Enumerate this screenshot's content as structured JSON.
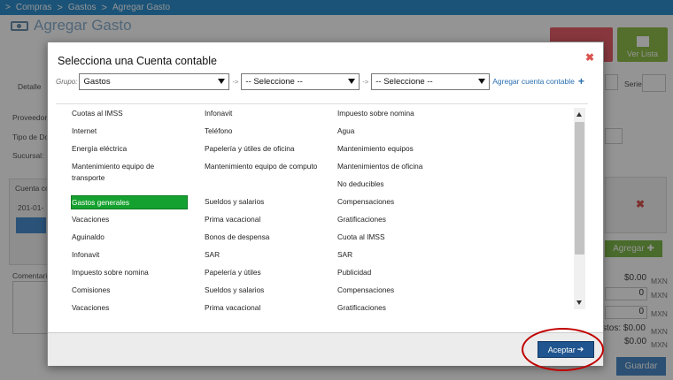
{
  "breadcrumb": {
    "items": [
      "Compras",
      "Gastos",
      "Agregar Gasto"
    ]
  },
  "background": {
    "page_title": "Agregar Gasto",
    "ver_lista_label": "Ver Lista",
    "tab_detalle": "Detalle",
    "field_labels": [
      "Proveedor",
      "Tipo de Do",
      "Sucursal:"
    ],
    "cuenta_label": "Cuenta co",
    "cuenta_value": "201-01-",
    "comentario_label": "Comentario",
    "serie_label": "Serie",
    "agregar_label": "Agregar",
    "amount_1": "$0.00",
    "amount_2": "0",
    "amount_3": "0",
    "amount_4": "stos: $0.00",
    "amount_5": "$0.00",
    "currency": "MXN",
    "guardar_label": "Guardar"
  },
  "modal": {
    "title": "Selecciona una Cuenta contable",
    "grupo_label": "Grupo:",
    "grupo_value": "Gastos",
    "select2_value": "-- Seleccione --",
    "select3_value": "-- Seleccione --",
    "arrow_text": "->",
    "add_link": "Agregar cuenta contable",
    "columns": [
      [
        "Cuotas al IMSS",
        "Internet",
        "Energía eléctrica",
        "Mantenimiento equipo de transporte",
        "Gastos generales",
        "Vacaciones",
        "Aguinaldo",
        "Infonavit",
        "Impuesto sobre nomina",
        "Comisiones",
        "Vacaciones"
      ],
      [
        "Infonavit",
        "Teléfono",
        "Papelería y útiles de oficina",
        "Mantenimiento equipo de computo",
        "Sueldos y salarios",
        "Prima vacacional",
        "Bonos de despensa",
        "SAR",
        "Papelería y útiles",
        "Sueldos y salarios",
        "Prima vacacional"
      ],
      [
        "Impuesto sobre nomina",
        "Agua",
        "Mantenimiento equipos",
        "Mantenimientos de oficina",
        "No deducibles",
        "Compensaciones",
        "Gratificaciones",
        "Cuota al IMSS",
        "SAR",
        "Publicidad",
        "Compensaciones",
        "Gratificaciones"
      ]
    ],
    "selected_item": "Gastos generales",
    "aceptar_label": "Aceptar"
  },
  "colors": {
    "breadcrumb_bg": "#2f8fcf",
    "selected_bg": "#15a12f",
    "primary_button": "#20558f",
    "highlight_ring": "#c00000"
  }
}
